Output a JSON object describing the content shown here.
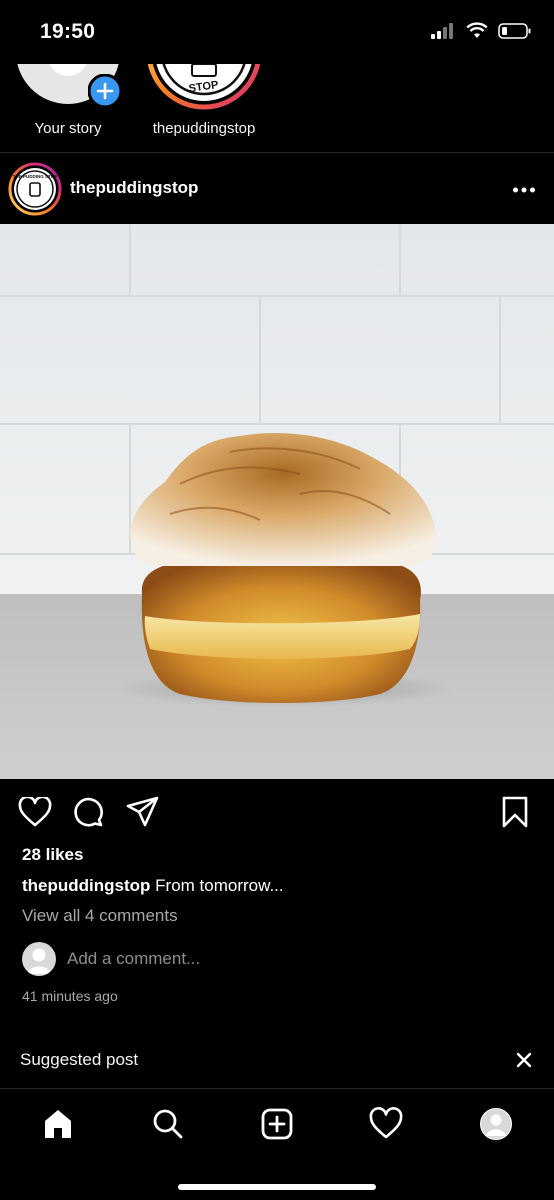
{
  "status": {
    "time": "19:50"
  },
  "stories": [
    {
      "label": "Your story"
    },
    {
      "label": "thepuddingstop",
      "ring_text": "STOP"
    }
  ],
  "post": {
    "username": "thepuddingstop",
    "logo_text": "THE PUDDING STOP",
    "likes": "28 likes",
    "caption_user": "thepuddingstop",
    "caption_text": "From tomorrow...",
    "view_comments": "View all 4 comments",
    "add_comment_placeholder": "Add a comment...",
    "timestamp": "41 minutes ago"
  },
  "suggested": {
    "label": "Suggested post"
  },
  "nav": [
    "home-icon",
    "search-icon",
    "create-icon",
    "activity-icon",
    "profile-icon"
  ],
  "colors": {
    "background": "#000000",
    "accent_blue": "#3897f0",
    "muted": "#a8a8a8"
  }
}
